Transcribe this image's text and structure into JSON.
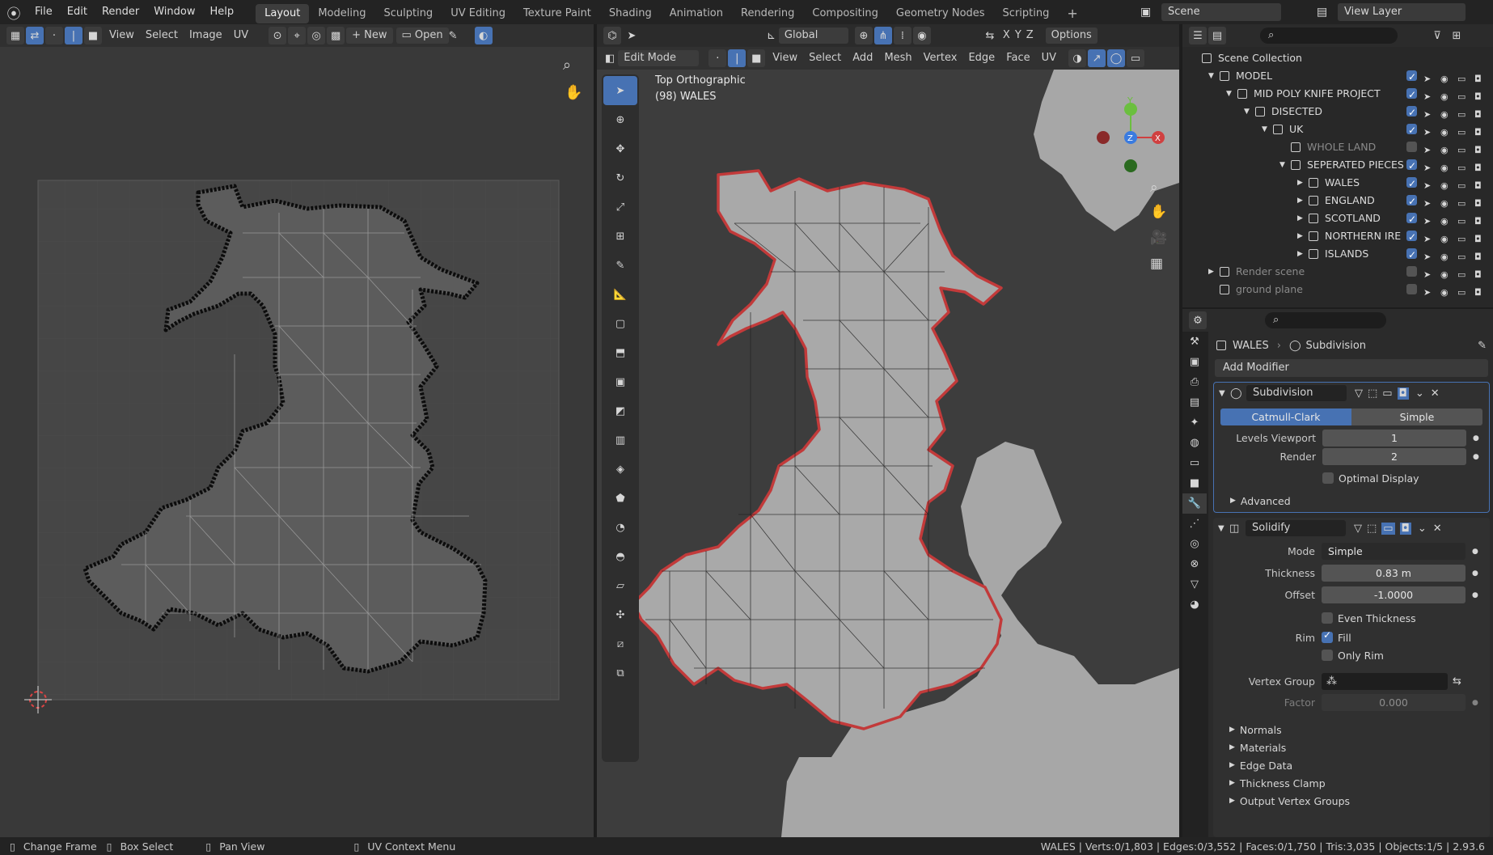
{
  "topbar": {
    "menus": [
      "File",
      "Edit",
      "Render",
      "Window",
      "Help"
    ],
    "workspaces": [
      "Layout",
      "Modeling",
      "Sculpting",
      "UV Editing",
      "Texture Paint",
      "Shading",
      "Animation",
      "Rendering",
      "Compositing",
      "Geometry Nodes",
      "Scripting"
    ],
    "active_workspace": "Layout",
    "scene": "Scene",
    "view_layer": "View Layer"
  },
  "uv_editor": {
    "menus": [
      "View",
      "Select",
      "Image",
      "UV"
    ],
    "new_label": "New",
    "open_label": "Open"
  },
  "viewport": {
    "mode": "Edit Mode",
    "menus": [
      "View",
      "Select",
      "Add",
      "Mesh",
      "Vertex",
      "Edge",
      "Face",
      "UV"
    ],
    "transform_orientation": "Global",
    "options_label": "Options",
    "view_name": "Top Orthographic",
    "object_label": "(98) WALES",
    "axes": [
      "X",
      "Y",
      "Z"
    ]
  },
  "outliner": {
    "items": [
      {
        "name": "Scene Collection",
        "depth": 0
      },
      {
        "name": "MODEL",
        "depth": 1
      },
      {
        "name": "MID POLY KNIFE PROJECT",
        "depth": 2
      },
      {
        "name": "DISECTED",
        "depth": 3
      },
      {
        "name": "UK",
        "depth": 4
      },
      {
        "name": "WHOLE LAND",
        "depth": 5
      },
      {
        "name": "SEPERATED PIECES",
        "depth": 5
      },
      {
        "name": "WALES",
        "depth": 6
      },
      {
        "name": "ENGLAND",
        "depth": 6
      },
      {
        "name": "SCOTLAND",
        "depth": 6
      },
      {
        "name": "NORTHERN IRE",
        "depth": 6
      },
      {
        "name": "ISLANDS",
        "depth": 6
      },
      {
        "name": "Render scene",
        "depth": 1
      },
      {
        "name": "ground plane",
        "depth": 1
      }
    ]
  },
  "properties": {
    "object_name": "WALES",
    "modifier_breadcrumb": "Subdivision",
    "add_modifier": "Add Modifier",
    "subdivision": {
      "name": "Subdivision",
      "type_options": [
        "Catmull-Clark",
        "Simple"
      ],
      "active_type": "Catmull-Clark",
      "levels_viewport_label": "Levels Viewport",
      "levels_viewport": "1",
      "render_label": "Render",
      "render": "2",
      "optimal_display": "Optimal Display",
      "advanced": "Advanced"
    },
    "solidify": {
      "name": "Solidify",
      "mode_label": "Mode",
      "mode": "Simple",
      "thickness_label": "Thickness",
      "thickness": "0.83 m",
      "offset_label": "Offset",
      "offset": "-1.0000",
      "even_thickness": "Even Thickness",
      "rim_label": "Rim",
      "fill": "Fill",
      "only_rim": "Only Rim",
      "vertex_group_label": "Vertex Group",
      "factor_label": "Factor",
      "factor": "0.000",
      "sections": [
        "Normals",
        "Materials",
        "Edge Data",
        "Thickness Clamp",
        "Output Vertex Groups"
      ]
    }
  },
  "statusbar": {
    "hints": [
      "Change Frame",
      "Box Select",
      "Pan View",
      "UV Context Menu"
    ],
    "stats": "WALES | Verts:0/1,803 | Edges:0/3,552 | Faces:0/1,750 | Tris:3,035 | Objects:1/5 | 2.93.6"
  },
  "colors": {
    "accent": "#4772b3",
    "selection_outline": "#c23a3a",
    "mesh_fill": "#a9a9a9",
    "background": "#3d3d3d"
  }
}
